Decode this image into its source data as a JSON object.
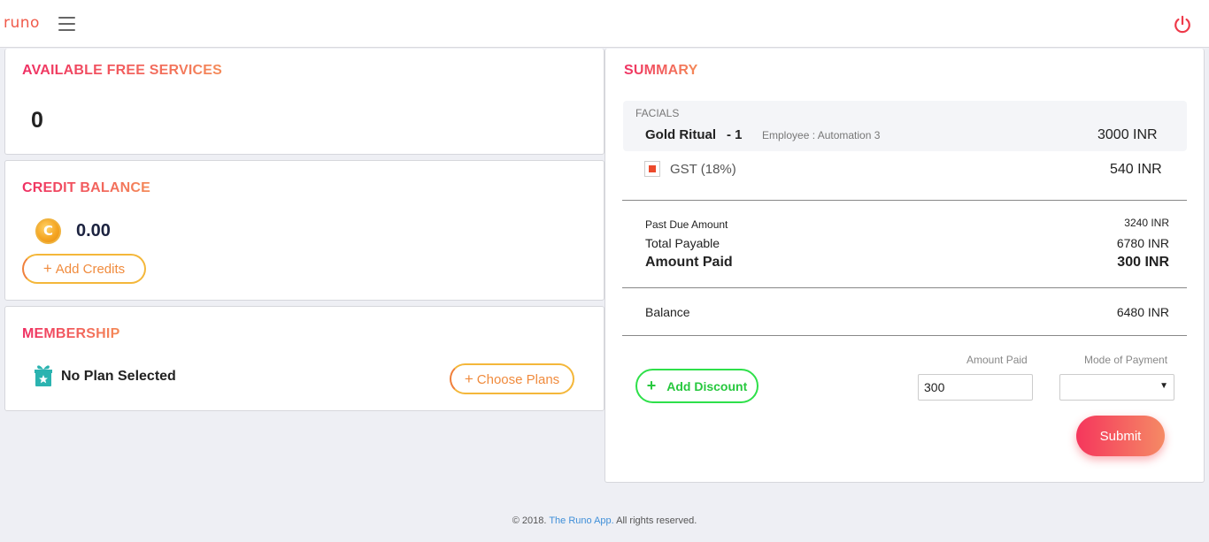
{
  "header": {
    "logo": "runo"
  },
  "free_services": {
    "title": "AVAILABLE FREE SERVICES",
    "count": "0"
  },
  "credit": {
    "title": "CREDIT BALANCE",
    "coin_symbol": "C",
    "balance": "0.00",
    "add_label": "Add Credits"
  },
  "membership": {
    "title": "MEMBERSHIP",
    "plan": "No Plan Selected",
    "choose_label": "Choose Plans"
  },
  "summary": {
    "title": "SUMMARY",
    "category": "FACIALS",
    "item": {
      "name": "Gold Ritual",
      "qty": "- 1",
      "employee": "Employee : Automation 3",
      "amount": "3000  INR"
    },
    "gst": {
      "label": "GST (18%)",
      "amount": "540  INR",
      "checked": true
    },
    "past_due": {
      "label": "Past Due Amount",
      "value": "3240 INR"
    },
    "total_payable": {
      "label": "Total Payable",
      "value": "6780 INR"
    },
    "amount_paid": {
      "label": "Amount Paid",
      "value": "300 INR"
    },
    "balance": {
      "label": "Balance",
      "value": "6480 INR"
    },
    "discount_label": "Add Discount",
    "amount_paid_field_label": "Amount Paid",
    "amount_paid_input": "300",
    "mode_label": "Mode of Payment",
    "mode_value": "",
    "submit_label": "Submit"
  },
  "footer": {
    "prefix": "© 2018.",
    "link": "The Runo App.",
    "suffix": "All rights reserved."
  },
  "colors": {
    "accent_start": "#ef2f63",
    "accent_end": "#f48a58",
    "discount": "#2ee04a",
    "link": "#3f8fd8"
  }
}
